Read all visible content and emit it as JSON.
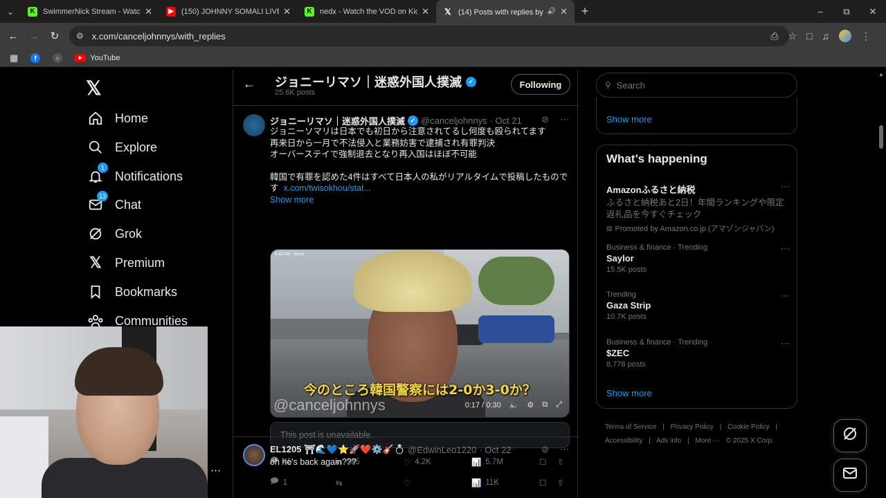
{
  "browser": {
    "tabs": [
      {
        "title": "SwimmerNick Stream - Watch L",
        "favicon": "kick-icon",
        "color": "#53fc18"
      },
      {
        "title": "(150) JOHNNY SOMALI LIVE FR",
        "favicon": "youtube-icon",
        "color": "#ff0000"
      },
      {
        "title": "nedx - Watch the VOD on Kick",
        "favicon": "kick-icon",
        "color": "#53fc18"
      },
      {
        "title": "(14) Posts with replies by ジ",
        "favicon": "x-icon",
        "color": "#ffffff"
      }
    ],
    "url": "x.com/canceljohnnys/with_replies",
    "bookmarks": [
      {
        "label": "",
        "icon": "facebook-icon"
      },
      {
        "label": "",
        "icon": "globe-icon"
      },
      {
        "label": "YouTube",
        "icon": "youtube-icon"
      }
    ]
  },
  "nav": {
    "items": [
      {
        "label": "Home",
        "icon": "home-icon"
      },
      {
        "label": "Explore",
        "icon": "search-icon"
      },
      {
        "label": "Notifications",
        "icon": "bell-icon",
        "badge": "1"
      },
      {
        "label": "Chat",
        "icon": "mail-icon",
        "badge": "13"
      },
      {
        "label": "Grok",
        "icon": "grok-icon"
      },
      {
        "label": "Premium",
        "icon": "x-icon"
      },
      {
        "label": "Bookmarks",
        "icon": "bookmark-icon"
      },
      {
        "label": "Communities",
        "icon": "communities-icon"
      }
    ],
    "more": "⋯"
  },
  "profile": {
    "name": "ジョニーリマソ｜迷惑外国人撲滅",
    "posts": "25.6K posts",
    "following_label": "Following"
  },
  "tweet1": {
    "name": "ジョニーリマソ｜迷惑外国人撲滅",
    "handle": "@canceljohnnys",
    "date": "· Oct 21",
    "lines": [
      "ジョニーソマリは日本でも初日から注意されてるし何度も殴られてます",
      "再来日から一月で不法侵入と業務妨害で逮捕され有罪判決",
      "オーバーステイで強制退去となり再入国はほぼ不可能",
      "韓国で有罪を認めた4件はすべて日本人の私がリアルタイムで投稿したもので",
      "す"
    ],
    "link": "x.com/twisokhou/stat...",
    "show_more": "Show more",
    "video": {
      "caption": "今のところ韓国警察には2-0か3-0か？",
      "watermark": "@canceljohnnys",
      "time_current": "0:17",
      "time_total": "/ 0:30",
      "corner_label": "9:42 AM · Seoul"
    },
    "unavailable": "This post is unavailable.",
    "stats": {
      "replies": "45",
      "reposts": "585",
      "likes": "4.2K",
      "views": "5.7M"
    }
  },
  "tweet2": {
    "name": "EL1205 ⛩🌊💙⭐🚀❤️⚙️🎸💍",
    "handle": "@EdwinLeo1220",
    "date": "· Oct 22",
    "text": "oh he's back again???",
    "stats": {
      "replies": "1",
      "reposts": "",
      "likes": "",
      "views": "11K"
    }
  },
  "sidebar": {
    "search_placeholder": "Search",
    "show_more_top": "Show more",
    "whats_happening": "What’s happening",
    "promo": {
      "title": "Amazonふるさと納税",
      "line1": "ふるさと納税あと2日！年間ランキングや限定",
      "line2": "返礼品を今すぐチェック",
      "by": "Promoted by Amazon.co.jp (アマゾンジャパン)"
    },
    "trends": [
      {
        "meta": "Business & finance · Trending",
        "name": "Saylor",
        "count": "15.5K posts"
      },
      {
        "meta": "Trending",
        "name": "Gaza Strip",
        "count": "10.7K posts"
      },
      {
        "meta": "Business & finance · Trending",
        "name": "$ZEC",
        "count": "8,778 posts"
      }
    ],
    "show_more_bottom": "Show more",
    "footer": {
      "links": [
        "Terms of Service",
        "|",
        "Privacy Policy",
        "|",
        "Cookie Policy",
        "|"
      ],
      "links2": [
        "Accessibility",
        "|",
        "Ads info",
        "|",
        "More ···",
        "© 2025 X Corp."
      ]
    }
  }
}
